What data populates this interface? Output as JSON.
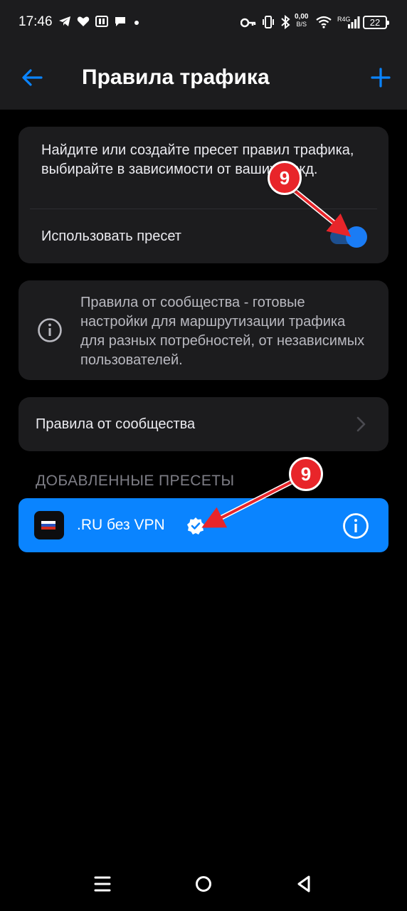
{
  "status_bar": {
    "time": "17:46",
    "net_speed_value": "0,00",
    "net_speed_unit": "B/S",
    "network_type": "R4G",
    "battery": "22",
    "icons": [
      "telegram-icon",
      "heart-icon",
      "app-icon",
      "chat-icon",
      "dot-icon",
      "key-icon",
      "vibrate-icon",
      "bluetooth-icon",
      "wifi-icon",
      "signal-icon",
      "battery-icon"
    ]
  },
  "app_bar": {
    "title": "Правила трафика",
    "back_icon": "arrow-left-icon",
    "add_icon": "plus-icon"
  },
  "preset_card": {
    "description": "Найдите или создайте пресет правил трафика, выбирайте в зависимости от ваших нужд.",
    "toggle_label": "Использовать пресет",
    "toggle_on": true
  },
  "info_card": {
    "icon": "info-icon",
    "text": "Правила от сообщества - готовые настройки для маршрутизации трафика для разных потребностей, от независимых пользователей."
  },
  "community_row": {
    "label": "Правила от сообщества",
    "chevron_icon": "chevron-right-icon"
  },
  "added_presets": {
    "header": "ДОБАВЛЕННЫЕ ПРЕСЕТЫ",
    "items": [
      {
        "name": ".RU без VPN",
        "verified": true,
        "thumb_icon": "russia-flag-icon",
        "info_icon": "info-icon"
      }
    ]
  },
  "annotations": [
    {
      "label": "9"
    },
    {
      "label": "9"
    }
  ],
  "nav_bar": {
    "buttons": [
      "menu-icon",
      "home-icon",
      "back-icon"
    ]
  },
  "colors": {
    "accent": "#0a84ff",
    "card": "#1c1c1e",
    "marker": "#e8252a",
    "toggle_track": "#1d4f8f",
    "toggle_knob": "#1a7cf5"
  }
}
